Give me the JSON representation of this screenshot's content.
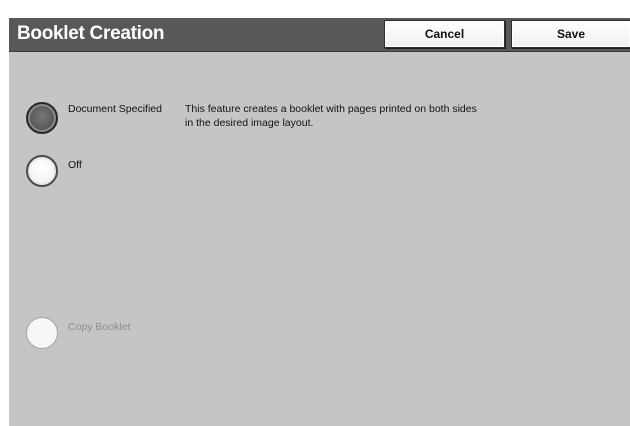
{
  "header": {
    "title": "Booklet Creation",
    "cancel_label": "Cancel",
    "save_label": "Save"
  },
  "options": [
    {
      "label": "Document Specified",
      "state": "selected"
    },
    {
      "label": "Off",
      "state": "unselected"
    },
    {
      "label": "Copy Booklet",
      "state": "disabled"
    }
  ],
  "description": "This feature creates a booklet with pages printed on both sides in the desired image layout.",
  "colors": {
    "title_bar": "#585858",
    "panel_background": "#c5c5c5",
    "selected_radio": "#5c5c5c"
  }
}
